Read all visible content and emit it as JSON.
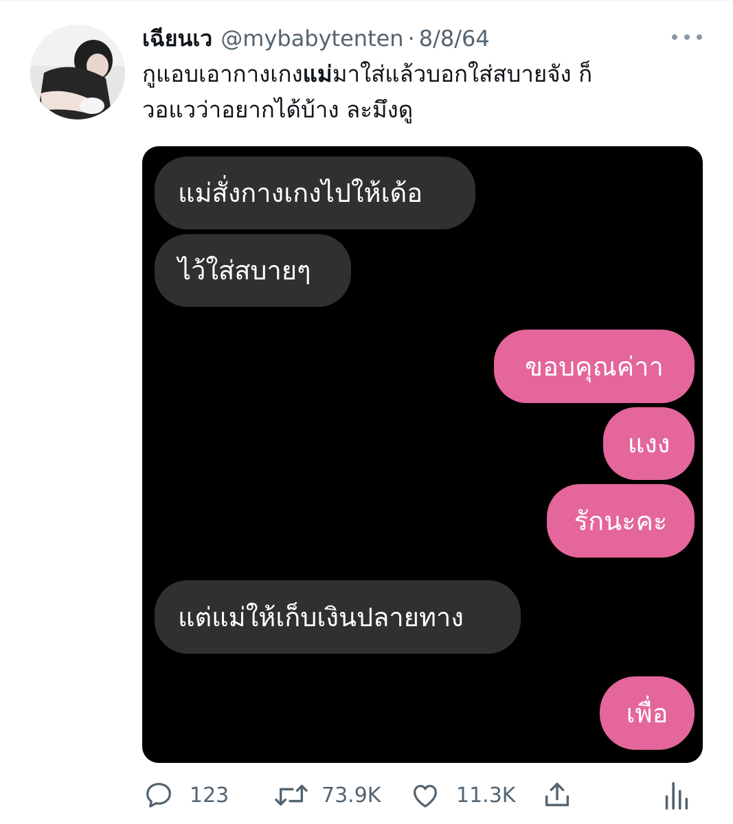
{
  "tweet": {
    "display_name": "เฉียนเว",
    "handle": "@mybabytenten",
    "separator": "·",
    "date": "8/8/64",
    "text_line1_pre": "กูแอบเอากางเกง",
    "text_line1_bold": "แม่",
    "text_line1_post": "มาใส่แล้วบอกใส่สบายจัง ก็",
    "text_line2": "วอแวว่าอยากได้บ้าง ละมึงดู"
  },
  "chat": {
    "messages": [
      {
        "side": "in",
        "text": "แม่สั่งกางเกงไปให้เด้อ"
      },
      {
        "side": "in",
        "text": "ไว้ใส่สบายๆ"
      },
      {
        "side": "out",
        "text": "ขอบคุณค่าา"
      },
      {
        "side": "out",
        "text": "แงง"
      },
      {
        "side": "out",
        "text": "รักนะคะ"
      },
      {
        "side": "in",
        "text": "แต่แม่ให้เก็บเงินปลายทาง"
      },
      {
        "side": "out",
        "text": "เพื่อ"
      }
    ],
    "incoming_color": "#303030",
    "outgoing_color": "#e4669b"
  },
  "actions": {
    "reply_icon": "speech-bubble-icon",
    "reply_count": "123",
    "retweet_icon": "retweet-arrows-icon",
    "retweet_count": "73.9K",
    "like_icon": "heart-icon",
    "like_count": "11.3K",
    "share_icon": "share-upload-icon",
    "analytics_icon": "bar-chart-icon"
  },
  "colors": {
    "text_primary": "#0f1419",
    "text_secondary": "#536471"
  }
}
